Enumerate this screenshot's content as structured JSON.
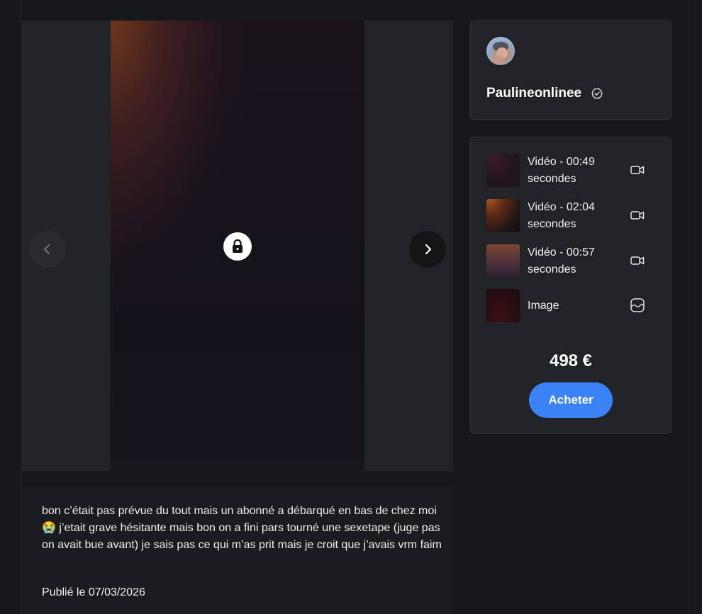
{
  "post": {
    "caption": "bon c’était pas prévue du tout mais un abonné a débarqué en bas de chez moi\n😭 j’etait grave hésitante mais bon on a fini pars tourné une sexetape (juge pas on avait bue avant) je sais pas ce qui m’as prit mais je croit que j’avais vrm faim",
    "published": "Publié le 07/03/2026"
  },
  "viewer": {
    "prev_icon": "chevron-left-icon",
    "next_icon": "chevron-right-icon",
    "lock_icon": "lock-icon"
  },
  "creator": {
    "username": "Paulineonlinee",
    "verified_icon": "verified-check-icon"
  },
  "bundle": {
    "items": [
      {
        "label": "Vidéo - 00:49 secondes",
        "icon": "video-camera-icon"
      },
      {
        "label": "Vidéo - 02:04 secondes",
        "icon": "video-camera-icon"
      },
      {
        "label": "Vidéo - 00:57 secondes",
        "icon": "video-camera-icon"
      },
      {
        "label": "Image",
        "icon": "image-icon"
      }
    ],
    "price": "498 €",
    "buy_label": "Acheter"
  },
  "colors": {
    "background": "#17181c",
    "card": "#222326",
    "accent": "#3b82f6"
  }
}
